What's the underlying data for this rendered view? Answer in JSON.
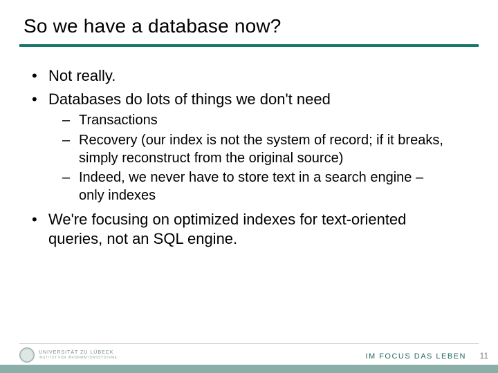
{
  "title": "So we have a database now?",
  "bullets": {
    "b1": "Not really.",
    "b2": "Databases do lots of things we don't need",
    "b2_sub": {
      "s1": "Transactions",
      "s2": "Recovery (our index is not the system of record; if it breaks, simply reconstruct from the original source)",
      "s3": "Indeed, we never have to store text in a search engine – only indexes"
    },
    "b3": "We're focusing on optimized indexes for text-oriented queries, not an SQL engine."
  },
  "footer": {
    "uni_line1": "UNIVERSITÄT ZU LÜBECK",
    "uni_line2": "INSTITUT FÜR INFORMATIONSSYSTEME",
    "tagline": "IM FOCUS DAS LEBEN",
    "page_number": "11"
  }
}
